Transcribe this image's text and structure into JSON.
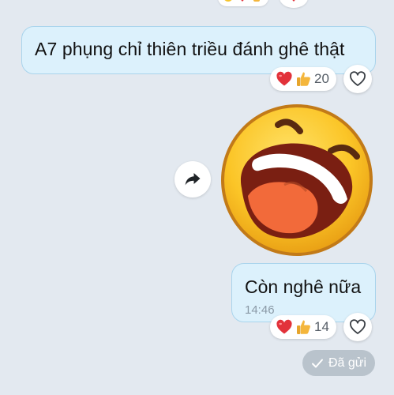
{
  "messages": [
    {
      "text": "A7 phụng chỉ thiên triều đánh ghê thật",
      "reactions": {
        "emojis": [
          "heart-icon",
          "thumbs-up-icon"
        ],
        "count": "20"
      }
    },
    {
      "type": "sticker",
      "sticker_name": "laughing-face-sticker"
    },
    {
      "text": "Còn nghê nữa",
      "time": "14:46",
      "reactions": {
        "emojis": [
          "heart-icon",
          "thumbs-up-icon"
        ],
        "count": "14"
      }
    }
  ],
  "status": {
    "label": "Đã gửi",
    "icon": "check-icon"
  },
  "colors": {
    "background": "#e3e9f0",
    "bubble": "#dcf1fc",
    "bubble_border": "#a9d4ec",
    "heart": "#e2323a",
    "thumb": "#f4b63c",
    "status_pill": "#b9c3cc"
  }
}
